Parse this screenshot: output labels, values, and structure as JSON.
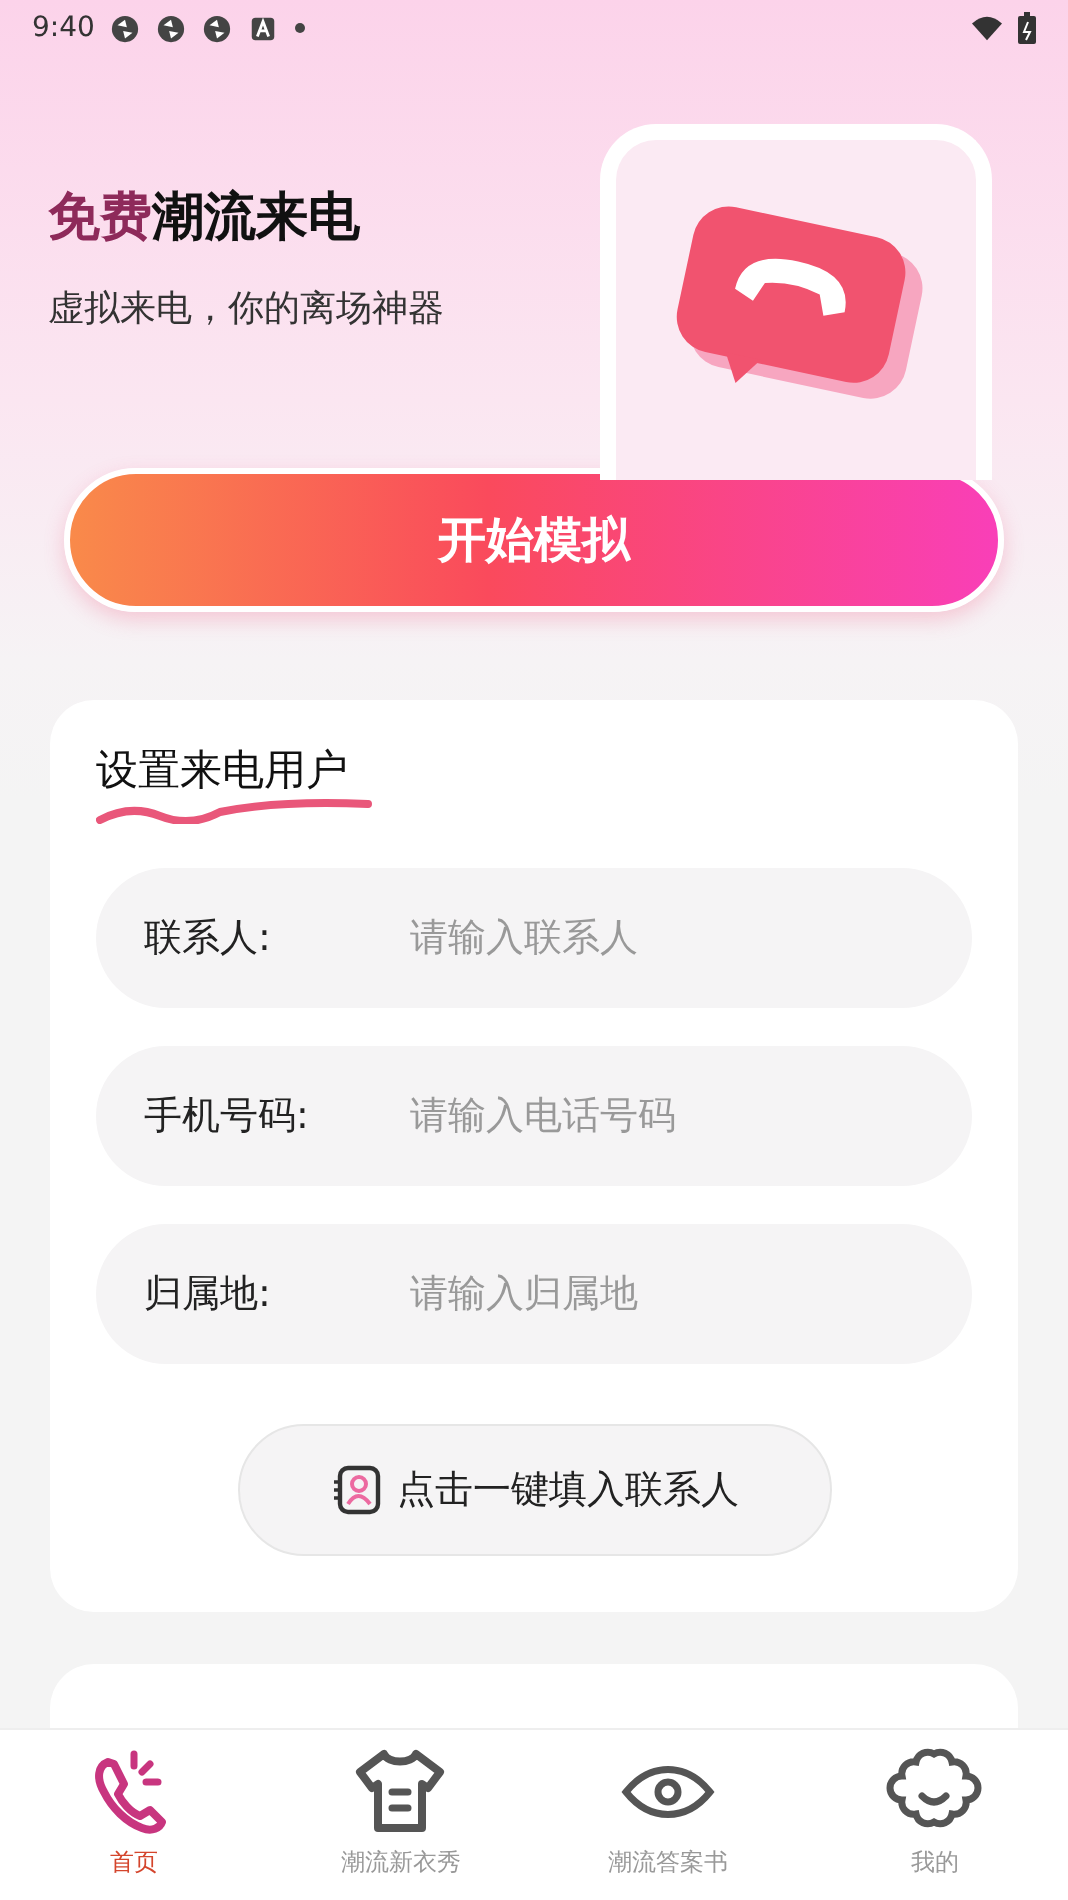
{
  "status_bar": {
    "time": "9:40"
  },
  "hero": {
    "title_accent": "免费",
    "title": "潮流来电",
    "subtitle": "虚拟来电，你的离场神器"
  },
  "start_button": {
    "label": "开始模拟"
  },
  "caller_card": {
    "title": "设置来电用户",
    "fields": [
      {
        "label": "联系人:",
        "placeholder": "请输入联系人"
      },
      {
        "label": "手机号码:",
        "placeholder": "请输入电话号码"
      },
      {
        "label": "归属地:",
        "placeholder": "请输入归属地"
      }
    ],
    "fill_button": {
      "label": "点击一键填入联系人"
    }
  },
  "bottom_nav": [
    {
      "kind": "phone",
      "label": "首页",
      "selected": true
    },
    {
      "kind": "shirt",
      "label": "潮流新衣秀",
      "selected": false
    },
    {
      "kind": "eye",
      "label": "潮流答案书",
      "selected": false
    },
    {
      "kind": "flower",
      "label": "我的",
      "selected": false
    }
  ]
}
